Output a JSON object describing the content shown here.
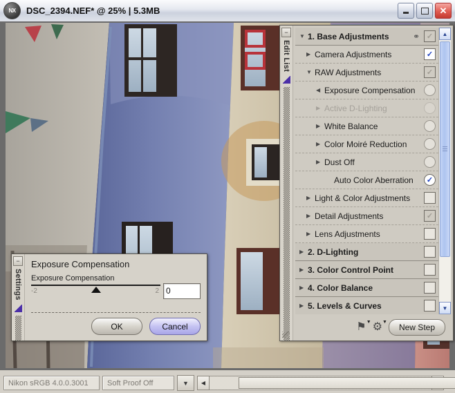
{
  "window": {
    "logo_text": "NX",
    "title": "DSC_2394.NEF* @ 25% | 5.3MB",
    "minimize_label": "Minimize",
    "maximize_label": "Maximize",
    "close_label": "✕"
  },
  "edit_list": {
    "tab_label": "Edit List",
    "collapse_label": "−",
    "rows": [
      {
        "label": "1. Base Adjustments",
        "indent": 0,
        "tri": "▼",
        "section": true,
        "disabled": false,
        "control": "check-gray",
        "mark": "✓",
        "chain": true
      },
      {
        "label": "Camera Adjustments",
        "indent": 1,
        "tri": "▶",
        "section": false,
        "disabled": false,
        "control": "check-blue",
        "mark": "✓",
        "chain": false
      },
      {
        "label": "RAW Adjustments",
        "indent": 1,
        "tri": "▼",
        "section": false,
        "disabled": false,
        "control": "check-gray",
        "mark": "✓",
        "chain": false
      },
      {
        "label": "Exposure Compensation",
        "indent": 2,
        "tri": "◀",
        "section": false,
        "disabled": false,
        "control": "circle",
        "mark": "",
        "chain": false
      },
      {
        "label": "Active D-Lighting",
        "indent": 2,
        "tri": "▶",
        "section": false,
        "disabled": true,
        "control": "circle-dim",
        "mark": "",
        "chain": false
      },
      {
        "label": "White Balance",
        "indent": 2,
        "tri": "▶",
        "section": false,
        "disabled": false,
        "control": "circle",
        "mark": "",
        "chain": false
      },
      {
        "label": "Color Moiré Reduction",
        "indent": 2,
        "tri": "▶",
        "section": false,
        "disabled": false,
        "control": "circle",
        "mark": "",
        "chain": false
      },
      {
        "label": "Dust Off",
        "indent": 2,
        "tri": "▶",
        "section": false,
        "disabled": false,
        "control": "circle",
        "mark": "",
        "chain": false
      },
      {
        "label": "Auto Color Aberration",
        "indent": 3,
        "tri": "",
        "section": false,
        "disabled": false,
        "control": "circle-on",
        "mark": "✓",
        "chain": false
      },
      {
        "label": "Light & Color Adjustments",
        "indent": 1,
        "tri": "▶",
        "section": false,
        "disabled": false,
        "control": "check-empty",
        "mark": "",
        "chain": false
      },
      {
        "label": "Detail Adjustments",
        "indent": 1,
        "tri": "▶",
        "section": false,
        "disabled": false,
        "control": "check-gray",
        "mark": "✓",
        "chain": false
      },
      {
        "label": "Lens Adjustments",
        "indent": 1,
        "tri": "▶",
        "section": false,
        "disabled": false,
        "control": "check-empty",
        "mark": "",
        "chain": false
      },
      {
        "label": "2. D-Lighting",
        "indent": 0,
        "tri": "▶",
        "section": true,
        "disabled": false,
        "control": "check-empty",
        "mark": "",
        "chain": false
      },
      {
        "label": "3. Color Control Point",
        "indent": 0,
        "tri": "▶",
        "section": true,
        "disabled": false,
        "control": "check-empty",
        "mark": "",
        "chain": false
      },
      {
        "label": "4. Color Balance",
        "indent": 0,
        "tri": "▶",
        "section": true,
        "disabled": false,
        "control": "check-empty",
        "mark": "",
        "chain": false
      },
      {
        "label": "5. Levels & Curves",
        "indent": 0,
        "tri": "▶",
        "section": true,
        "disabled": false,
        "control": "check-empty",
        "mark": "",
        "chain": false
      }
    ],
    "scroll_up": "▲",
    "scroll_down": "▼",
    "tools": {
      "flag_icon_label": "flag",
      "gear_icon_label": "settings",
      "dropdown_caret": "▼",
      "new_step_label": "New Step"
    }
  },
  "exposure_dialog": {
    "tab_label": "Settings",
    "collapse_label": "−",
    "title": "Exposure Compensation",
    "slider_label": "Exposure Compensation",
    "slider_min": "-2",
    "slider_max": "2",
    "value": "0",
    "ok_label": "OK",
    "cancel_label": "Cancel"
  },
  "status_bar": {
    "color_profile": "Nikon sRGB 4.0.0.3001",
    "soft_proof": "Soft Proof Off",
    "dropdown_caret": "▼",
    "scroll_left": "◀",
    "scroll_right": "▶"
  },
  "colors": {
    "accent_blue": "#1b3fc0",
    "chrome": "#d4d0c8",
    "panel": "#cfcbc2",
    "default_button": "#a9a6e8"
  }
}
